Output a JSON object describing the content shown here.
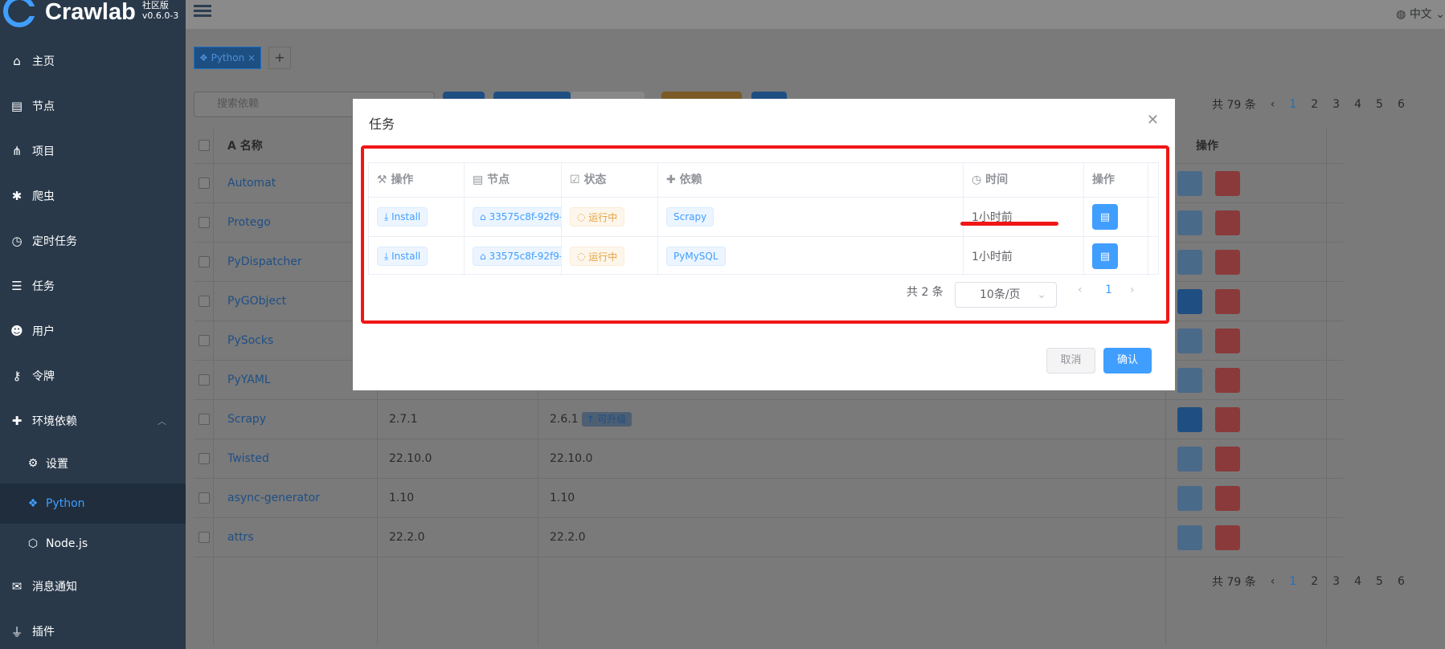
{
  "app": {
    "name": "Crawlab",
    "edition": "社区版",
    "version": "v0.6.0-3"
  },
  "header": {
    "language": "中文"
  },
  "sidebar": {
    "items": [
      {
        "label": "主页",
        "icon": "home-icon"
      },
      {
        "label": "节点",
        "icon": "server-icon"
      },
      {
        "label": "项目",
        "icon": "project-icon"
      },
      {
        "label": "爬虫",
        "icon": "spider-icon"
      },
      {
        "label": "定时任务",
        "icon": "clock-icon"
      },
      {
        "label": "任务",
        "icon": "task-list-icon"
      },
      {
        "label": "用户",
        "icon": "users-icon"
      },
      {
        "label": "令牌",
        "icon": "key-icon"
      },
      {
        "label": "环境依赖",
        "icon": "puzzle-icon"
      }
    ],
    "sub_items": [
      {
        "label": "设置",
        "icon": "gear-icon"
      },
      {
        "label": "Python",
        "icon": "python-icon"
      },
      {
        "label": "Node.js",
        "icon": "nodejs-icon"
      }
    ],
    "bottom_items": [
      {
        "label": "消息通知",
        "icon": "mail-icon"
      },
      {
        "label": "插件",
        "icon": "plug-icon"
      }
    ]
  },
  "tabs": [
    {
      "label": "Python"
    }
  ],
  "background": {
    "search_placeholder": "搜索依赖",
    "total": "共 79 条",
    "pages": [
      "1",
      "2",
      "3",
      "4",
      "5",
      "6"
    ],
    "columns": {
      "name": "名称",
      "actions": "操作"
    },
    "rows": [
      {
        "name": "Automat",
        "version": "",
        "latest": ""
      },
      {
        "name": "Protego",
        "version": "",
        "latest": ""
      },
      {
        "name": "PyDispatcher",
        "version": "",
        "latest": ""
      },
      {
        "name": "PyGObject",
        "version": "",
        "latest": ""
      },
      {
        "name": "PySocks",
        "version": "",
        "latest": ""
      },
      {
        "name": "PyYAML",
        "version": "",
        "latest": ""
      },
      {
        "name": "Scrapy",
        "version": "2.7.1",
        "latest": "2.6.1",
        "upgrade": "可升级"
      },
      {
        "name": "Twisted",
        "version": "22.10.0",
        "latest": "22.10.0"
      },
      {
        "name": "async-generator",
        "version": "1.10",
        "latest": "1.10"
      },
      {
        "name": "attrs",
        "version": "22.2.0",
        "latest": "22.2.0"
      }
    ]
  },
  "modal": {
    "title": "任务",
    "columns": [
      "操作",
      "节点",
      "状态",
      "依赖",
      "时间",
      "操作"
    ],
    "rows": [
      {
        "action": "Install",
        "node": "33575c8f-92f9-",
        "status": "运行中",
        "dependency": "Scrapy",
        "time": "1小时前"
      },
      {
        "action": "Install",
        "node": "33575c8f-92f9-",
        "status": "运行中",
        "dependency": "PyMySQL",
        "time": "1小时前"
      }
    ],
    "pagination": {
      "total": "共 2 条",
      "page_size": "10条/页",
      "current": "1"
    },
    "cancel": "取消",
    "confirm": "确认"
  },
  "colors": {
    "primary": "#409eff",
    "danger": "#f56c6c",
    "highlight": "#f01616",
    "sidebar": "#29394a"
  }
}
